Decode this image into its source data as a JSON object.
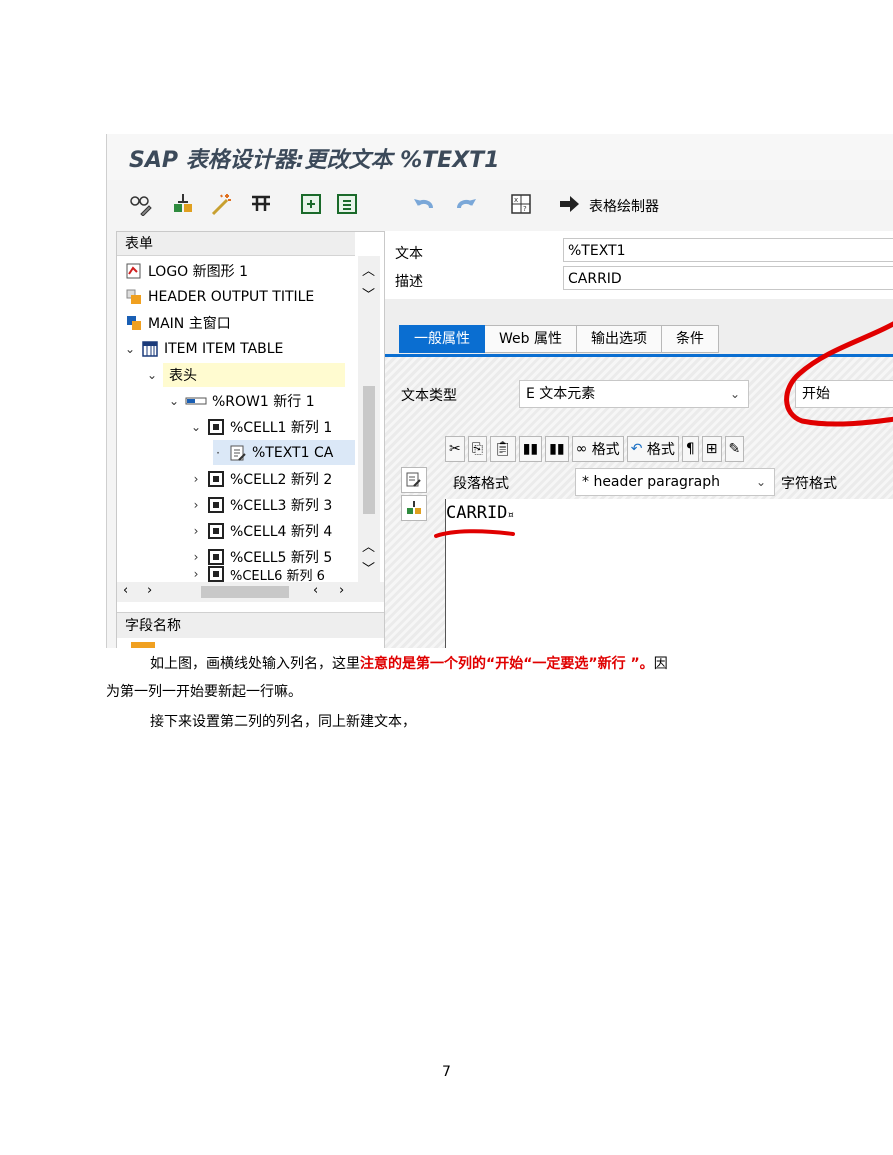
{
  "window": {
    "title": "SAP 表格设计器:更改文本 %TEXT1",
    "toolbar": {
      "painter_label": "表格绘制器"
    }
  },
  "tree": {
    "header": "表单",
    "items": [
      {
        "label": "LOGO 新图形 1",
        "icon": "graphic-icon"
      },
      {
        "label": "HEADER OUTPUT TITILE",
        "icon": "window-icon"
      },
      {
        "label": "MAIN 主窗口",
        "icon": "main-window-icon"
      },
      {
        "label": "ITEM ITEM TABLE",
        "icon": "table-icon"
      },
      {
        "label": "表头",
        "icon": ""
      },
      {
        "label": "%ROW1 新行 1",
        "icon": "row-icon"
      },
      {
        "label": "%CELL1 新列 1",
        "icon": "cell-icon"
      },
      {
        "label": "%TEXT1 CA",
        "icon": "text-icon"
      },
      {
        "label": "%CELL2 新列 2",
        "icon": "cell-icon"
      },
      {
        "label": "%CELL3 新列 3",
        "icon": "cell-icon"
      },
      {
        "label": "%CELL4 新列 4",
        "icon": "cell-icon"
      },
      {
        "label": "%CELL5 新列 5",
        "icon": "cell-icon"
      },
      {
        "label": "%CELL6 新列 6",
        "icon": "cell-icon"
      }
    ],
    "field_panel_header": "字段名称"
  },
  "detail": {
    "text_label": "文本",
    "text_value": "%TEXT1",
    "desc_label": "描述",
    "desc_value": "CARRID",
    "tabs": [
      "一般属性",
      "Web 属性",
      "输出选项",
      "条件"
    ],
    "text_type_label": "文本类型",
    "text_type_value": "E 文本元素",
    "start_value": "开始",
    "editor_toolbar": {
      "format1": "格式",
      "format2": "格式"
    },
    "para_format_label": "段落格式",
    "para_format_value": "* header paragraph",
    "char_format_label": "字符格式",
    "editor_text": "CARRID",
    "editor_mark": "¤"
  },
  "document": {
    "p1_a": "如上图，画横线处输入列名，这里",
    "p1_red": "注意的是第一个列的“开始“一定要选”新行 ”。",
    "p1_b": "因",
    "p1_line2": "为第一列一开始要新起一行嘛。",
    "p2": "接下来设置第二列的列名，同上新建文本，",
    "page_number": "7"
  },
  "colors": {
    "accent": "#0a6ed1",
    "annotation": "#e00000",
    "highlight": "#fffbd0"
  }
}
